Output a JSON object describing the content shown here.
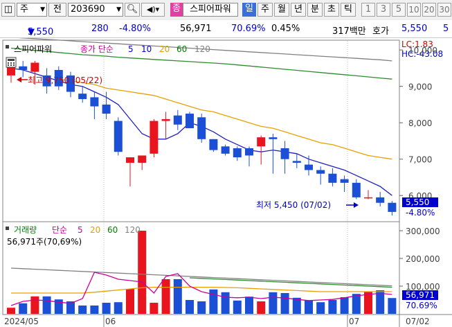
{
  "toolbar": {
    "market": "주",
    "jeon_label": "전",
    "code": "203690",
    "indicator_label": "스피어파워",
    "jong_label": "종",
    "periods": [
      "일",
      "주",
      "월",
      "년",
      "분",
      "초",
      "틱"
    ],
    "active_period": "일",
    "minute_options": [
      "1",
      "3",
      "5",
      "10",
      "20",
      "30"
    ]
  },
  "quote": {
    "price": "5,550",
    "change": "280",
    "change_pct": "-4.80%",
    "volume": "56,971",
    "volume_ratio": "70.69%",
    "turnover": "0.45%",
    "amount": "317백만",
    "ask_label": "호가",
    "ask_price": "5,550",
    "ask_extra": "5",
    "colors": {
      "down": "#0000cc",
      "up": "#d00000"
    }
  },
  "price_panel": {
    "legend_name": "스피어파워",
    "legend_ma": "종가 단순",
    "ma_periods": [
      {
        "label": "5",
        "color": "#0000cc"
      },
      {
        "label": "10",
        "color": "#0000cc"
      },
      {
        "label": "20",
        "color": "#e0a000"
      },
      {
        "label": "60",
        "color": "#008000"
      },
      {
        "label": "120",
        "color": "#808080"
      }
    ],
    "lc_label": "LC:1.83",
    "hc_label": "HC:-43.08",
    "high_annotation": "최고 9,750 (05/22)",
    "low_annotation": "최저 5,450 (07/02)",
    "last_price_badge": "5,550",
    "last_change_badge": "-4.80%",
    "y_ticks": [
      "10,000",
      "9,000",
      "8,000",
      "7,000",
      "6,000"
    ]
  },
  "volume_panel": {
    "legend_name": "거래량",
    "legend_ma": "단순",
    "ma_periods": [
      {
        "label": "5",
        "color": "#cc0099"
      },
      {
        "label": "20",
        "color": "#e0a000"
      },
      {
        "label": "60",
        "color": "#008000"
      },
      {
        "label": "120",
        "color": "#808080"
      }
    ],
    "info": "56,971주(70,69%)",
    "last_volume_badge": "56,971",
    "last_ratio_badge": "70.69%",
    "y_ticks": [
      "300,000",
      "200,000",
      "100,000"
    ]
  },
  "x_axis": [
    "2024/05",
    "06",
    "07",
    "07/02"
  ],
  "chart_data": {
    "type": "candlestick",
    "symbol": "203690",
    "y_range": [
      5300,
      10250
    ],
    "volume_range": [
      0,
      330000
    ],
    "candles": [
      {
        "o": 9300,
        "h": 9750,
        "l": 9100,
        "c": 9650
      },
      {
        "o": 9550,
        "h": 9700,
        "l": 9250,
        "c": 9450
      },
      {
        "o": 9400,
        "h": 9700,
        "l": 9050,
        "c": 9650
      },
      {
        "o": 9300,
        "h": 9500,
        "l": 8800,
        "c": 9000
      },
      {
        "o": 9450,
        "h": 9550,
        "l": 8900,
        "c": 9000
      },
      {
        "o": 9300,
        "h": 9400,
        "l": 8700,
        "c": 8850
      },
      {
        "o": 8800,
        "h": 9000,
        "l": 8550,
        "c": 8650
      },
      {
        "o": 8700,
        "h": 8850,
        "l": 8100,
        "c": 8450
      },
      {
        "o": 8500,
        "h": 8850,
        "l": 8100,
        "c": 8250
      },
      {
        "o": 8050,
        "h": 8150,
        "l": 7100,
        "c": 7200
      },
      {
        "o": 6900,
        "h": 7050,
        "l": 6250,
        "c": 7050
      },
      {
        "o": 6900,
        "h": 7100,
        "l": 6700,
        "c": 7100
      },
      {
        "o": 7150,
        "h": 8100,
        "l": 7050,
        "c": 8050
      },
      {
        "o": 8050,
        "h": 8300,
        "l": 7550,
        "c": 8100
      },
      {
        "o": 8200,
        "h": 8350,
        "l": 7800,
        "c": 7950
      },
      {
        "o": 8250,
        "h": 8300,
        "l": 7850,
        "c": 7850
      },
      {
        "o": 8150,
        "h": 8250,
        "l": 7450,
        "c": 7550
      },
      {
        "o": 7550,
        "h": 7550,
        "l": 7200,
        "c": 7250
      },
      {
        "o": 7350,
        "h": 7400,
        "l": 7100,
        "c": 7150
      },
      {
        "o": 7300,
        "h": 7350,
        "l": 6950,
        "c": 7050
      },
      {
        "o": 7300,
        "h": 7350,
        "l": 6800,
        "c": 7100
      },
      {
        "o": 7350,
        "h": 7650,
        "l": 6850,
        "c": 7600
      },
      {
        "o": 7600,
        "h": 7700,
        "l": 6600,
        "c": 7550
      },
      {
        "o": 7300,
        "h": 7500,
        "l": 6600,
        "c": 7000
      },
      {
        "o": 6950,
        "h": 7150,
        "l": 6750,
        "c": 6900
      },
      {
        "o": 6850,
        "h": 7100,
        "l": 6550,
        "c": 6700
      },
      {
        "o": 6700,
        "h": 6800,
        "l": 6300,
        "c": 6600
      },
      {
        "o": 6600,
        "h": 6750,
        "l": 6250,
        "c": 6350
      },
      {
        "o": 6450,
        "h": 6550,
        "l": 6100,
        "c": 6350
      },
      {
        "o": 6350,
        "h": 6450,
        "l": 5900,
        "c": 5950
      },
      {
        "o": 5950,
        "h": 6150,
        "l": 5900,
        "c": 5950
      },
      {
        "o": 5950,
        "h": 6100,
        "l": 5700,
        "c": 5800
      },
      {
        "o": 5800,
        "h": 5850,
        "l": 5450,
        "c": 5550
      }
    ],
    "volumes": [
      22000,
      38000,
      63000,
      63000,
      52000,
      45000,
      30000,
      30000,
      40000,
      42000,
      90000,
      300000,
      40000,
      125000,
      125000,
      50000,
      45000,
      88000,
      78000,
      48000,
      62000,
      45000,
      78000,
      75000,
      58000,
      48000,
      42000,
      50000,
      60000,
      72000,
      80000,
      85000,
      57000
    ],
    "ma5": [
      9500,
      9450,
      9350,
      9250,
      9150,
      9050,
      9000,
      8850,
      8700,
      8500,
      8100,
      7700,
      7550,
      7550,
      7700,
      8000,
      7900,
      7750,
      7550,
      7400,
      7250,
      7200,
      7250,
      7200,
      7150,
      7000,
      6900,
      6800,
      6700,
      6550,
      6400,
      6250,
      6000
    ],
    "ma20": [
      null,
      null,
      null,
      null,
      9200,
      9150,
      9100,
      9050,
      8950,
      8900,
      8850,
      8800,
      8750,
      8650,
      8550,
      8450,
      8350,
      8300,
      8200,
      8100,
      8000,
      7900,
      7850,
      7750,
      7650,
      7550,
      7450,
      7400,
      7300,
      7200,
      7100,
      7050,
      7000
    ],
    "ma60": [
      10050,
      10020,
      9990,
      9960,
      9930,
      9900,
      9870,
      9850,
      9830,
      9800,
      9780,
      9760,
      9740,
      9720,
      9700,
      9680,
      9660,
      9640,
      9620,
      9590,
      9560,
      9530,
      9500,
      9470,
      9440,
      9410,
      9380,
      9350,
      9320,
      9290,
      9260,
      9230,
      9200
    ],
    "ma120": [
      10350,
      10330,
      10310,
      10290,
      10270,
      10250,
      10230,
      10210,
      10190,
      10170,
      10150,
      10130,
      10110,
      10090,
      10070,
      10050,
      10030,
      10010,
      9990,
      9970,
      9950,
      9930,
      9910,
      9890,
      9870,
      9850,
      9830,
      9810,
      9790,
      9770,
      9750,
      9730,
      9700
    ],
    "vol_ma5": [
      30000,
      45000,
      50000,
      48000,
      42000,
      38000,
      55000,
      150000,
      140000,
      125000,
      120000,
      115000,
      75000,
      135000,
      145000,
      100000,
      80000,
      70000,
      60000,
      58000,
      60000,
      55000,
      60000,
      57000,
      52000,
      48000,
      50000,
      52000,
      58000,
      65000,
      70000,
      74000,
      70000
    ],
    "vol_ma20": [
      75000,
      75000,
      75000,
      75000,
      75000,
      75000,
      75000,
      78000,
      82000,
      86000,
      90000,
      94000,
      96000,
      96000,
      96000,
      96000,
      96000,
      96000,
      95000,
      94000,
      92000,
      90000,
      88000,
      86000,
      84000,
      82000,
      80000,
      80000,
      80000,
      80000,
      80000,
      80000,
      80000
    ],
    "vol_ma60": [
      null,
      null,
      null,
      null,
      null,
      null,
      null,
      null,
      null,
      null,
      null,
      null,
      null,
      null,
      null,
      130000,
      128000,
      126000,
      124000,
      122000,
      120000,
      118000,
      116000,
      114000,
      112000,
      110000,
      108000,
      106000,
      104000,
      102000,
      100000,
      98000,
      96000
    ],
    "vol_ma120": [
      165000,
      163000,
      161000,
      159000,
      157000,
      155000,
      153000,
      151000,
      149000,
      147000,
      145000,
      143000,
      141000,
      139000,
      137000,
      135000,
      133000,
      131000,
      129000,
      127000,
      125000,
      123000,
      121000,
      119000,
      117000,
      115000,
      113000,
      111000,
      109000,
      107000,
      105000,
      103000,
      101000
    ]
  }
}
